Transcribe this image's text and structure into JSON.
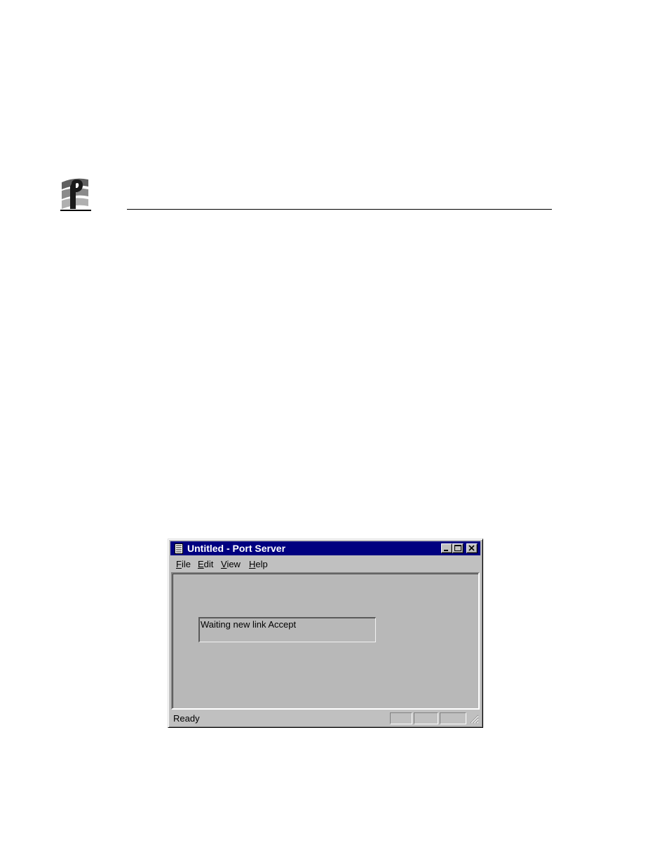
{
  "window": {
    "title": "Untitled - Port Server"
  },
  "menu": {
    "items": [
      {
        "mnemonic": "F",
        "rest": "ile"
      },
      {
        "mnemonic": "E",
        "rest": "dit"
      },
      {
        "mnemonic": "V",
        "rest": "iew"
      },
      {
        "mnemonic": "H",
        "rest": "elp"
      }
    ]
  },
  "content": {
    "status_box_text": "Waiting new link Accept"
  },
  "statusbar": {
    "text": "Ready"
  },
  "icons": {
    "logo": "company-logo",
    "app": "document-icon",
    "minimize": "minimize-icon",
    "maximize": "maximize-icon",
    "close": "close-icon",
    "grip": "resize-grip-icon"
  },
  "colors": {
    "titlebar": "#000080",
    "window_face": "#c0c0c0",
    "client": "#b8b8b8"
  }
}
